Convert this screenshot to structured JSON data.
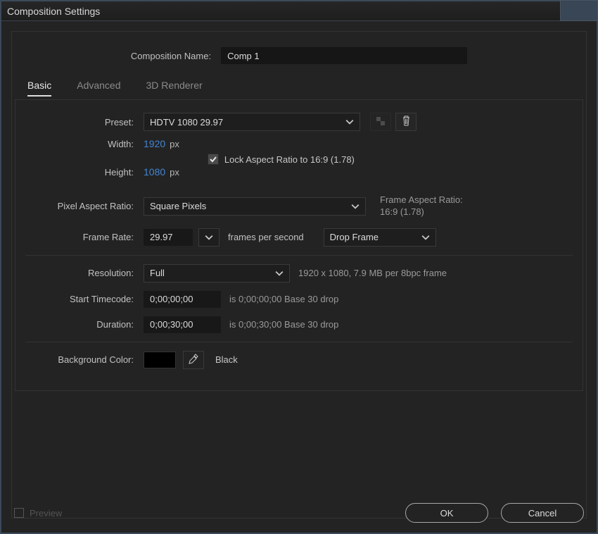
{
  "window": {
    "title": "Composition Settings"
  },
  "comp_name": {
    "label": "Composition Name:",
    "value": "Comp 1"
  },
  "tabs": {
    "basic": "Basic",
    "advanced": "Advanced",
    "renderer": "3D Renderer"
  },
  "preset": {
    "label": "Preset:",
    "value": "HDTV 1080 29.97"
  },
  "width": {
    "label": "Width:",
    "value": "1920",
    "unit": "px"
  },
  "height": {
    "label": "Height:",
    "value": "1080",
    "unit": "px"
  },
  "lock_aspect": {
    "label": "Lock Aspect Ratio to 16:9 (1.78)",
    "checked": true
  },
  "pixel_aspect": {
    "label": "Pixel Aspect Ratio:",
    "value": "Square Pixels"
  },
  "frame_aspect": {
    "l1": "Frame Aspect Ratio:",
    "l2": "16:9 (1.78)"
  },
  "frame_rate": {
    "label": "Frame Rate:",
    "value": "29.97",
    "unit": "frames per second",
    "drop": "Drop Frame"
  },
  "resolution": {
    "label": "Resolution:",
    "value": "Full",
    "hint": "1920 x 1080, 7.9 MB per 8bpc frame"
  },
  "start_tc": {
    "label": "Start Timecode:",
    "value": "0;00;00;00",
    "hint": "is 0;00;00;00  Base 30  drop"
  },
  "duration": {
    "label": "Duration:",
    "value": "0;00;30;00",
    "hint": "is 0;00;30;00  Base 30  drop"
  },
  "bg": {
    "label": "Background Color:",
    "name": "Black",
    "hex": "#000000"
  },
  "footer": {
    "preview": "Preview",
    "ok": "OK",
    "cancel": "Cancel"
  }
}
